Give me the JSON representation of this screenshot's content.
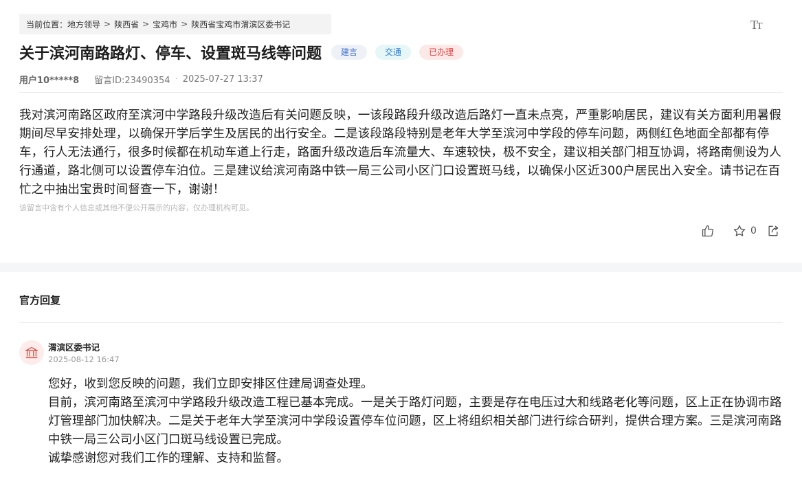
{
  "breadcrumb": {
    "prefix": "当前位置：",
    "items": [
      "地方领导",
      "陕西省",
      "宝鸡市",
      "陕西省宝鸡市渭滨区委书记"
    ],
    "separator": ">"
  },
  "font_toggle": {
    "big": "T",
    "small": "T"
  },
  "post": {
    "title": "关于滨河南路路灯、停车、设置斑马线等问题",
    "tags": [
      "建言",
      "交通",
      "已办理"
    ],
    "user": "用户10*****8",
    "message_id": "留言ID:23490354",
    "datetime": "2025-07-27 13:37",
    "content": "我对滨河南路区政府至滨河中学路段升级改造后有关问题反映，一该段路段升级改造后路灯一直未点亮，严重影响居民，建议有关方面利用暑假期间尽早安排处理，以确保开学后学生及居民的出行安全。二是该段路段特别是老年大学至滨河中学段的停车问题，两侧红色地面全部都有停车，行人无法通行，很多时候都在机动车道上行走，路面升级改造后车流量大、车速较快，极不安全，建议相关部门相互协调，将路南侧设为人行通道，路北侧可以设置停车泊位。三是建议给滨河南路中铁一局三公司小区门口设置斑马线，以确保小区近300户居民出入安全。请书记在百忙之中抽出宝贵时间督查一下，谢谢！",
    "privacy_note": "该留言中含有个人信息或其他不便公开展示的内容，仅办理机构可见。",
    "favorite_count": "0"
  },
  "official_reply": {
    "section_title": "官方回复",
    "org_name": "渭滨区委书记",
    "datetime": "2025-08-12 16:47",
    "paragraphs": [
      "您好，收到您反映的问题，我们立即安排区住建局调查处理。",
      "目前，滨河南路至滨河中学路段升级改造工程已基本完成。一是关于路灯问题，主要是存在电压过大和线路老化等问题，区上正在协调市路灯管理部门加快解决。二是关于老年大学至滨河中学段设置停车位问题，区上将组织相关部门进行综合研判，提供合理方案。三是滨河南路中铁一局三公司小区门口斑马线设置已完成。",
      "诚挚感谢您对我们工作的理解、支持和监督。"
    ]
  },
  "icons": {
    "like": "thumbs-up-icon",
    "favorite": "star-icon",
    "share": "share-icon",
    "avatar": "government-building-icon",
    "font_size": "font-size-icon"
  },
  "colors": {
    "tag_blue_bg": "#eef1f6",
    "tag_cyan_bg": "#e7f6f6",
    "tag_red_bg": "#fde8e8",
    "tag_red_text": "#e13e3e",
    "avatar_bg": "#fdeceb",
    "avatar_icon": "#e25b4f"
  }
}
